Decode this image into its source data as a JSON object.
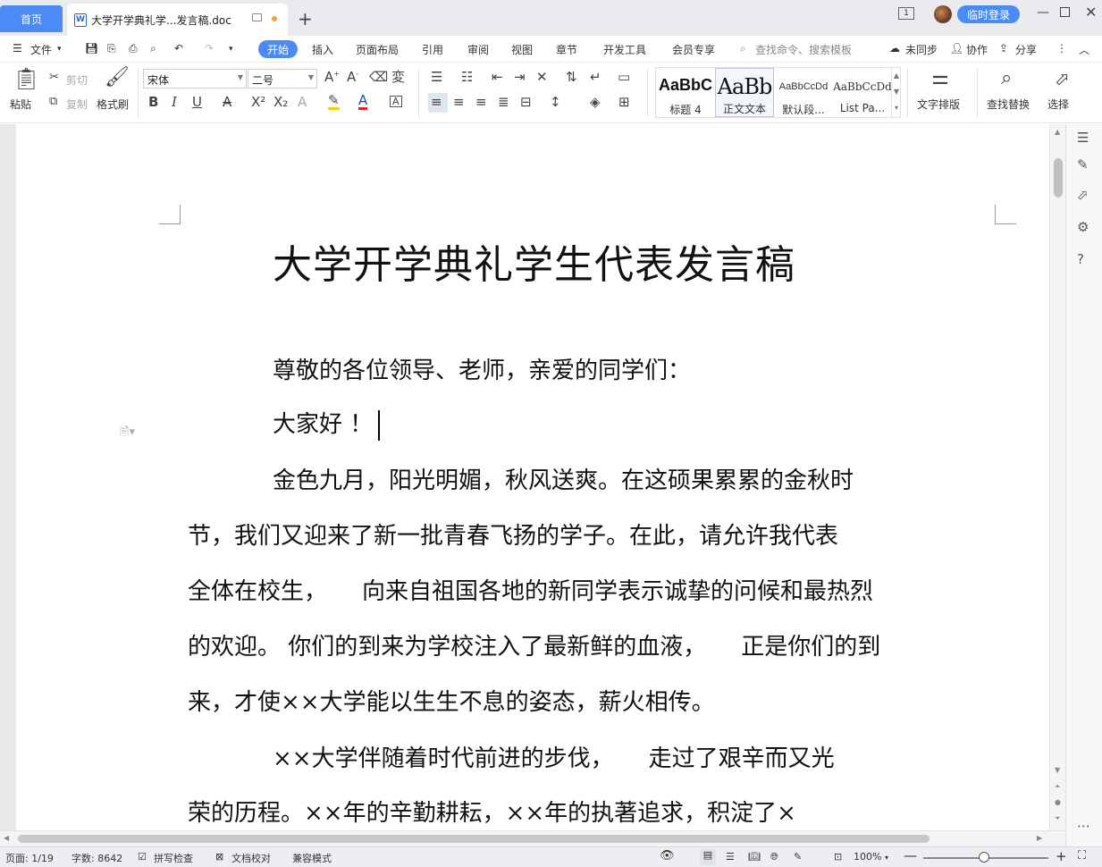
{
  "tabs": {
    "home": "首页",
    "doc_title": "大学开学典礼学...发言稿.doc"
  },
  "titlebar": {
    "login": "临时登录",
    "badge": "1"
  },
  "menu": {
    "file": "文件",
    "start": "开始",
    "items": [
      "插入",
      "页面布局",
      "引用",
      "审阅",
      "视图",
      "章节",
      "开发工具",
      "会员专享"
    ],
    "search": "查找命令、搜索模板",
    "unsynced": "未同步",
    "collab": "协作",
    "share": "分享"
  },
  "ribbon": {
    "paste": "粘贴",
    "cut": "剪切",
    "copy": "复制",
    "format_painter": "格式刷",
    "font_name": "宋体",
    "font_size": "二号",
    "styles": [
      {
        "preview": "AaBbC",
        "label": "标题 4"
      },
      {
        "preview": "AaBb",
        "label": "正文文本"
      },
      {
        "preview": "AaBbCcDd",
        "label": "默认段..."
      },
      {
        "preview": "AaBbCcDd",
        "label": "List Pa..."
      }
    ],
    "text_layout": "文字排版",
    "find_replace": "查找替换",
    "select": "选择"
  },
  "document": {
    "title": "大学开学典礼学生代表发言稿",
    "lines": [
      "尊敬的各位领导、老师，亲爱的同学们：",
      "大家好 ！",
      "金色九月，阳光明媚，秋风送爽。在这硕果累累的金秋时",
      "节，我们又迎来了新一批青春飞扬的学子。在此，请允许我代表",
      "全体在校生，　　向来自祖国各地的新同学表示诚挚的问候和最热烈",
      "的欢迎。 你们的到来为学校注入了最新鲜的血液，　　正是你们的到",
      "来，才使××大学能以生生不息的姿态，薪火相传。",
      "××大学伴随着时代前进的步伐，　　走过了艰辛而又光",
      "荣的历程。××年的辛勤耕耘，××年的执著追求，积淀了×"
    ]
  },
  "status": {
    "page": "页面: 1/19",
    "words": "字数: 8642",
    "spell": "拼写检查",
    "proof": "文档校对",
    "compat": "兼容模式",
    "zoom": "100%"
  },
  "colors": {
    "accent": "#4b8bf5",
    "tab_dot": "#f2a22f"
  }
}
